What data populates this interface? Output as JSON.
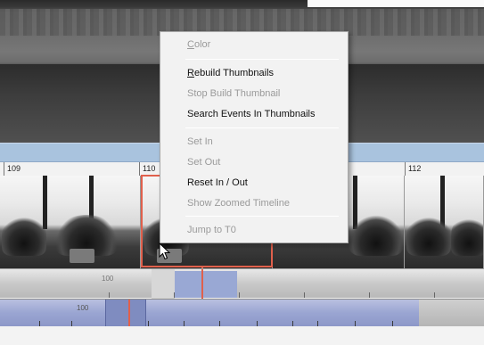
{
  "ruler": {
    "labels": [
      "109",
      "110",
      "112"
    ]
  },
  "track1": {
    "label": "100"
  },
  "track2": {
    "label": "100"
  },
  "context_menu": {
    "items": [
      {
        "label": "Color",
        "mnemonic": "C",
        "rest": "olor",
        "enabled": false
      },
      {
        "label": "Rebuild Thumbnails",
        "mnemonic": "R",
        "rest": "ebuild Thumbnails",
        "enabled": true
      },
      {
        "label": "Stop Build Thumbnail",
        "enabled": false
      },
      {
        "label": "Search Events In Thumbnails",
        "enabled": true
      },
      {
        "label": "Set In",
        "enabled": false
      },
      {
        "label": "Set Out",
        "enabled": false
      },
      {
        "label": "Reset In / Out",
        "enabled": true
      },
      {
        "label": "Show Zoomed Timeline",
        "enabled": false
      },
      {
        "label": "Jump to T0",
        "enabled": false
      }
    ]
  },
  "colors": {
    "selection": "#e0604c",
    "timeline_blue": "#99a8d4",
    "ruler_bar": "#a9c3de"
  },
  "icons": {
    "cursor": "arrow-pointer-icon"
  }
}
